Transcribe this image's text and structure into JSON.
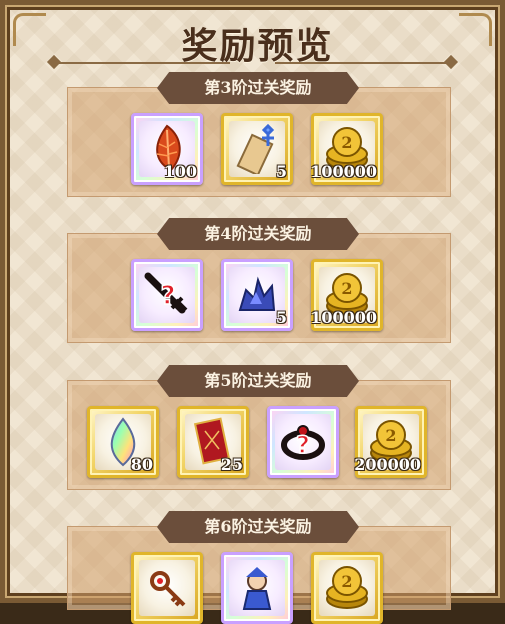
{
  "title": "奖励预览",
  "sections": [
    {
      "label": "第3阶过关奖励",
      "items": [
        {
          "icon": "red-feather-icon",
          "qty": "100"
        },
        {
          "icon": "scroll-ticket-icon",
          "qty": "5"
        },
        {
          "icon": "gold-coin-icon",
          "qty": "100000"
        }
      ]
    },
    {
      "label": "第4阶过关奖励",
      "items": [
        {
          "icon": "mystery-sword-icon",
          "qty": ""
        },
        {
          "icon": "blue-dragon-icon",
          "qty": "5"
        },
        {
          "icon": "gold-coin-icon",
          "qty": "100000"
        }
      ]
    },
    {
      "label": "第5阶过关奖励",
      "items": [
        {
          "icon": "rainbow-gem-icon",
          "qty": "80"
        },
        {
          "icon": "red-card-icon",
          "qty": "25"
        },
        {
          "icon": "mystery-ring-icon",
          "qty": ""
        },
        {
          "icon": "gold-coin-icon",
          "qty": "200000"
        }
      ]
    },
    {
      "label": "第6阶过关奖励",
      "items": [
        {
          "icon": "key-staff-icon",
          "qty": ""
        },
        {
          "icon": "blue-hero-icon",
          "qty": ""
        },
        {
          "icon": "gold-coin-icon",
          "qty": ""
        }
      ]
    }
  ],
  "colors": {
    "gold": "#e0b52a",
    "banner": "#6b4e3b",
    "section": "#d2a06e"
  }
}
